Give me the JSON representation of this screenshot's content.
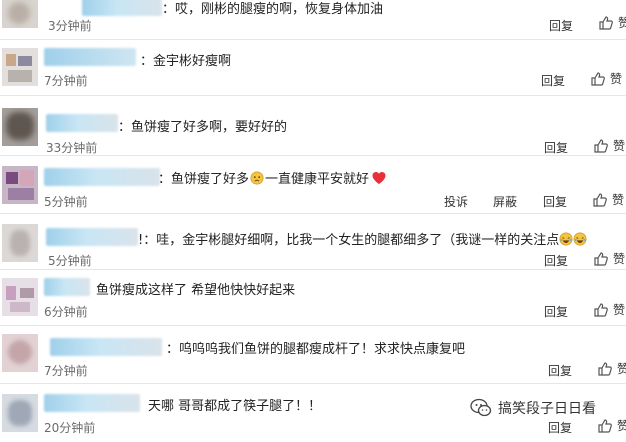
{
  "comments": [
    {
      "text": "：哎，刚彬的腿瘦的啊，恢复身体加油",
      "time": "3分钟前",
      "reply": "回复",
      "like": "赞"
    },
    {
      "text": "：金宇彬好瘦啊",
      "time": "7分钟前",
      "reply": "回复",
      "like": "赞"
    },
    {
      "text": "：鱼饼瘦了好多啊，要好好的",
      "time": "33分钟前",
      "reply": "回复",
      "like": "赞"
    },
    {
      "text_before": "：鱼饼瘦了好多",
      "text_after": "一直健康平安就好",
      "time": "5分钟前",
      "report": "投诉",
      "block": "屏蔽",
      "reply": "回复",
      "like": "赞"
    },
    {
      "text": "!：哇，金宇彬腿好细啊，比我一个女生的腿都细多了（我谜一样的关注点",
      "time": "5分钟前",
      "reply": "回复",
      "like": "赞"
    },
    {
      "text": "鱼饼瘦成这样了 希望他快快好起来",
      "time": "6分钟前",
      "reply": "回复",
      "like": "赞"
    },
    {
      "text": "：呜呜呜我们鱼饼的腿都瘦成杆了！求求快点康复吧",
      "time": "7分钟前",
      "reply": "回复",
      "like": "赞"
    },
    {
      "text": "天哪 哥哥都成了筷子腿了！！",
      "time": "20分钟前",
      "reply": "回复",
      "like": "赞"
    }
  ],
  "watermark": {
    "text": "搞笑段子日日看"
  },
  "colors": {
    "heart": "#e8303a",
    "accent_name": "#a9d8ee"
  }
}
